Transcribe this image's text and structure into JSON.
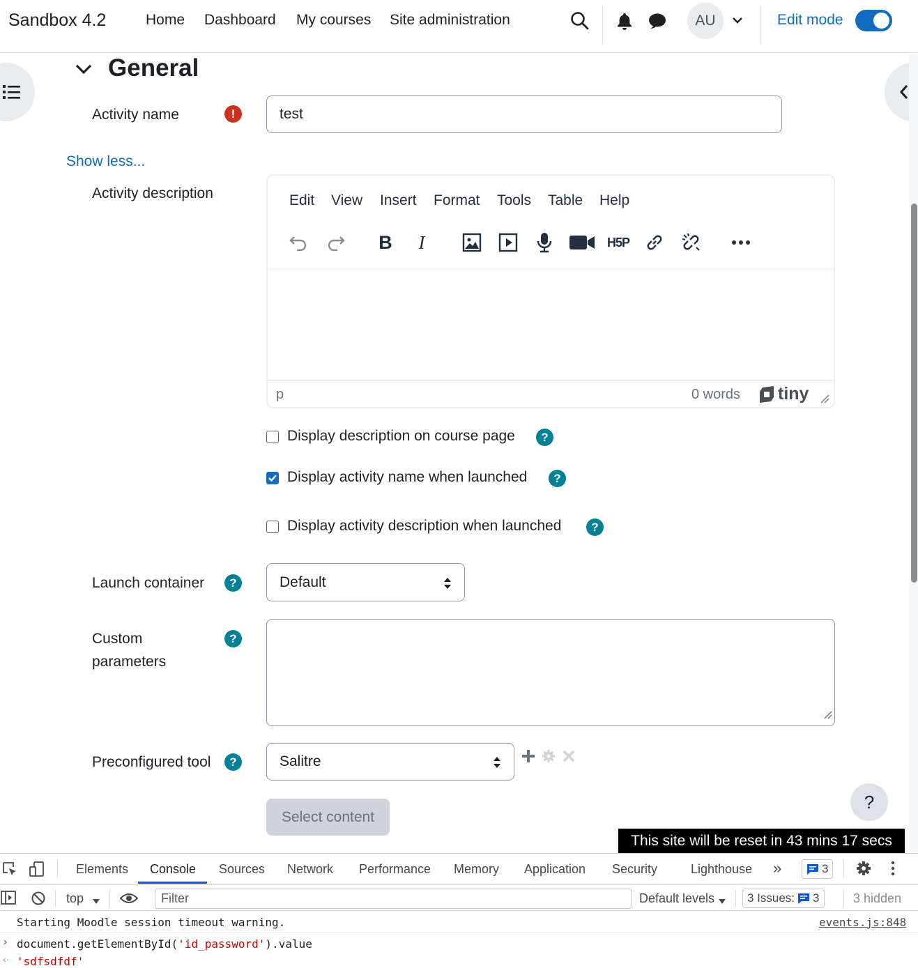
{
  "navbar": {
    "brand": "Sandbox 4.2",
    "links": [
      "Home",
      "Dashboard",
      "My courses",
      "Site administration"
    ],
    "avatar_initials": "AU",
    "edit_mode_label": "Edit mode",
    "edit_mode_on": true
  },
  "section": {
    "title": "General"
  },
  "form": {
    "activity_name_label": "Activity name",
    "activity_name_value": "test",
    "show_less_label": "Show less...",
    "activity_description_label": "Activity description",
    "editor": {
      "menus": [
        "Edit",
        "View",
        "Insert",
        "Format",
        "Tools",
        "Table",
        "Help"
      ],
      "toolbar_icons": [
        "undo-icon",
        "redo-icon",
        "bold-icon",
        "italic-icon",
        "image-icon",
        "media-icon",
        "record-audio-icon",
        "record-video-icon",
        "h5p-icon",
        "link-icon",
        "unlink-icon",
        "more-icon"
      ],
      "bold_glyph": "B",
      "italic_glyph": "I",
      "h5p_glyph": "H5P",
      "status_path": "p",
      "word_count": "0 words",
      "brand": "tiny"
    },
    "checkboxes": [
      {
        "label": "Display description on course page",
        "checked": false
      },
      {
        "label": "Display activity name when launched",
        "checked": true
      },
      {
        "label": "Display activity description when launched",
        "checked": false
      }
    ],
    "launch_container_label": "Launch container",
    "launch_container_value": "Default",
    "custom_parameters_label_line1": "Custom",
    "custom_parameters_label_line2": "parameters",
    "preconfigured_tool_label": "Preconfigured tool",
    "preconfigured_tool_value": "Salitre",
    "select_content_label": "Select content",
    "help_glyph": "?",
    "required_glyph": "!"
  },
  "help_fab": "?",
  "reset_banner": "This site will be reset in 43 mins 17 secs",
  "devtools": {
    "tabs": [
      "Elements",
      "Console",
      "Sources",
      "Network",
      "Performance",
      "Memory",
      "Application",
      "Security",
      "Lighthouse"
    ],
    "active_tab": "Console",
    "more_tabs": "»",
    "messages_count": "3",
    "context": "top",
    "filter_placeholder": "Filter",
    "default_levels": "Default levels",
    "issues_label": "3 Issues:",
    "issues_count": "3",
    "hidden_label": "3 hidden",
    "console": [
      {
        "text": "Starting Moodle session timeout warning.",
        "source": "events.js:848"
      },
      {
        "input_prefix": "document.getElementById(",
        "input_arg": "'id_password'",
        "input_suffix": ").value"
      },
      {
        "output": "'sdfsdfdf'"
      }
    ]
  },
  "colors": {
    "brand_blue": "#0f6cbf",
    "help_teal": "#008196",
    "required_red": "#ca3120"
  }
}
